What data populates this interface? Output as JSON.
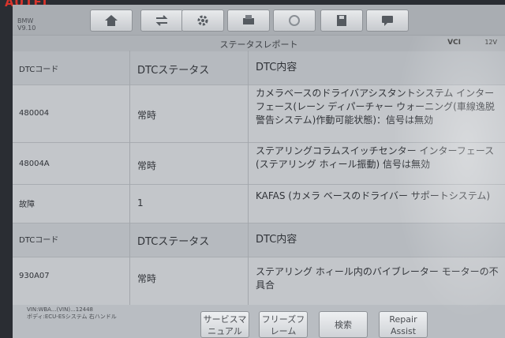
{
  "device": {
    "logo": "AUTEL"
  },
  "vehicle": {
    "make": "BMW",
    "version": "V9.10"
  },
  "toolbar": {
    "buttons": [
      {
        "name": "home-button",
        "icon": "home-icon"
      },
      {
        "name": "vehicle-swap-button",
        "icon": "car-swap-icon"
      },
      {
        "name": "settings-button",
        "icon": "gear-icon"
      },
      {
        "name": "print-button",
        "icon": "printer-icon"
      },
      {
        "name": "browser-button",
        "icon": "globe-icon"
      },
      {
        "name": "save-button",
        "icon": "save-icon"
      },
      {
        "name": "message-button",
        "icon": "chat-icon"
      }
    ]
  },
  "page": {
    "title": "ステータスレポート",
    "vci_label": "VCI",
    "battery_label": "12V"
  },
  "table": {
    "headers": {
      "code": "DTCコード",
      "status": "DTCステータス",
      "content": "DTC内容"
    },
    "rows": [
      {
        "code": "480004",
        "status": "常時",
        "content": "カメラベースのドライバアシスタントシステム インターフェース(レーン ディパーチャー ウォーニング(車線逸脱警告システム)作動可能状態)：信号は無効"
      },
      {
        "code": "48004A",
        "status": "常時",
        "content": "ステアリングコラムスイッチセンター インターフェース(ステアリング ホィール振動) 信号は無効"
      },
      {
        "code": "故障",
        "status": "1",
        "content": "KAFAS (カメラ ベースのドライバー サポートシステム)"
      }
    ],
    "headers2": {
      "code": "DTCコード",
      "status": "DTCステータス",
      "content": "DTC内容"
    },
    "rows2": [
      {
        "code": "930A07",
        "status": "常時",
        "content": "ステアリング ホィール内のバイブレーター モーターの不具合"
      }
    ]
  },
  "footer": {
    "vin_line1": "VIN:WBA...(VIN)...12448",
    "vin_line2": "ボディ:ECU-ESシステム 右ハンドル",
    "buttons": [
      "サービスマニュアル",
      "フリーズフレーム",
      "検索",
      "Repair Assist"
    ]
  },
  "colors": {
    "screen_bg": "#c3c6ca",
    "header_bg": "#b6babf",
    "text": "#303338"
  }
}
